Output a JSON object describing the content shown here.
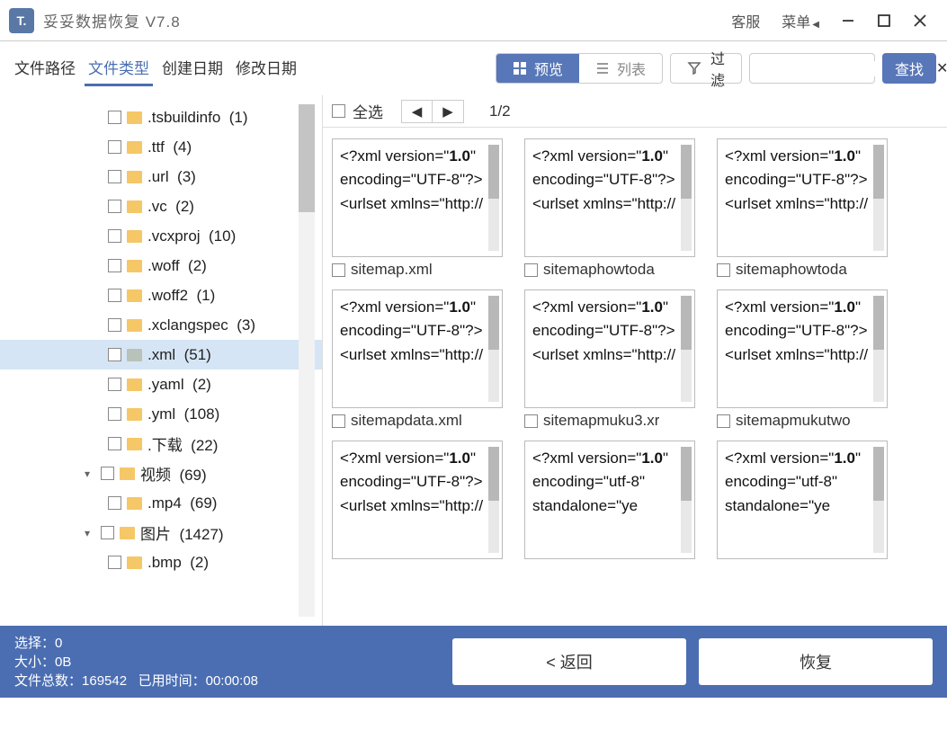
{
  "app": {
    "icon_text": "T.",
    "title": "妥妥数据恢复  V7.8"
  },
  "titlebar": {
    "support": "客服",
    "menu": "菜单"
  },
  "tabs": {
    "path": "文件路径",
    "type": "文件类型",
    "created": "创建日期",
    "modified": "修改日期"
  },
  "toolbar": {
    "preview": "预览",
    "list": "列表",
    "filter": "过滤",
    "find": "查找"
  },
  "main_header": {
    "select_all": "全选",
    "page": "1/2"
  },
  "tree": [
    {
      "kind": "leaf",
      "label": ".tsbuildinfo",
      "count": "(1)"
    },
    {
      "kind": "leaf",
      "label": ".ttf",
      "count": "(4)"
    },
    {
      "kind": "leaf",
      "label": ".url",
      "count": "(3)"
    },
    {
      "kind": "leaf",
      "label": ".vc",
      "count": "(2)"
    },
    {
      "kind": "leaf",
      "label": ".vcxproj",
      "count": "(10)"
    },
    {
      "kind": "leaf",
      "label": ".woff",
      "count": "(2)"
    },
    {
      "kind": "leaf",
      "label": ".woff2",
      "count": "(1)"
    },
    {
      "kind": "leaf",
      "label": ".xclangspec",
      "count": "(3)"
    },
    {
      "kind": "leaf",
      "label": ".xml",
      "count": "(51)",
      "selected": true,
      "gray": true
    },
    {
      "kind": "leaf",
      "label": ".yaml",
      "count": "(2)"
    },
    {
      "kind": "leaf",
      "label": ".yml",
      "count": "(108)"
    },
    {
      "kind": "leaf",
      "label": ".下载",
      "count": "(22)"
    },
    {
      "kind": "branch",
      "label": "视频",
      "count": "(69)"
    },
    {
      "kind": "leaf",
      "label": ".mp4",
      "count": "(69)"
    },
    {
      "kind": "branch",
      "label": "图片",
      "count": "(1427)"
    },
    {
      "kind": "leaf",
      "label": ".bmp",
      "count": "(2)"
    }
  ],
  "xml_snippet_a": "<?xml version=\"1.0\" encoding=\"UTF-8\"?> <urlset xmlns=\"http://",
  "xml_snippet_b": "<?xml version=\"1.0\" encoding=\"utf-8\" standalone=\"ye",
  "files": [
    {
      "name": "sitemap.xml",
      "snip": "a"
    },
    {
      "name": "sitemaphowtoda",
      "snip": "a"
    },
    {
      "name": "sitemaphowtoda",
      "snip": "a"
    },
    {
      "name": "sitemapdata.xml",
      "snip": "a"
    },
    {
      "name": "sitemapmuku3.xr",
      "snip": "a"
    },
    {
      "name": "sitemapmukutwo",
      "snip": "a"
    },
    {
      "name": "",
      "snip": "a"
    },
    {
      "name": "",
      "snip": "b"
    },
    {
      "name": "",
      "snip": "b"
    }
  ],
  "footer": {
    "sel_label": "选择：",
    "sel_val": "0",
    "size_label": "大小：",
    "size_val": "0B",
    "total_label": "文件总数：",
    "total_val": "169542",
    "time_label": "已用时间：",
    "time_val": "00:00:08",
    "back": "< 返回",
    "recover": "恢复"
  }
}
